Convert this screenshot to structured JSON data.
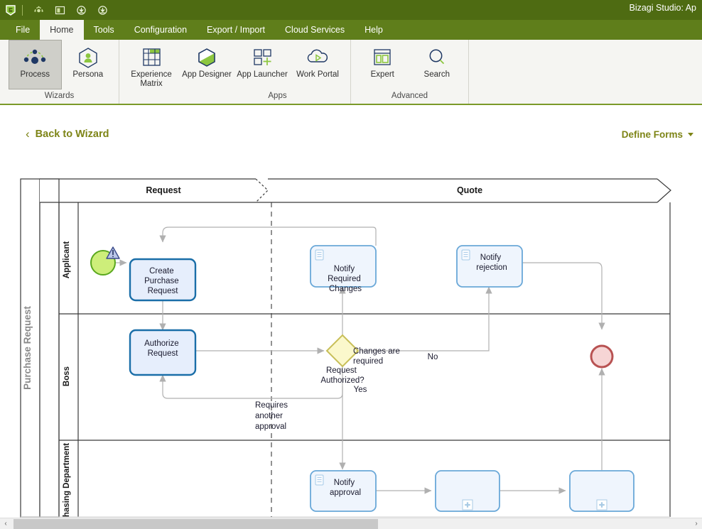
{
  "window": {
    "title": "Bizagi Studio: Ap",
    "accent_green": "#4e6b12",
    "menu_green": "#5f7e1b",
    "ribbon_bg": "#f5f5f2",
    "link_olive": "#7d8416"
  },
  "quick_access": {
    "logo_icon": "bizagi-logo-icon",
    "buttons": [
      {
        "icon": "refresh-circle-icon",
        "name": "quick-refresh"
      },
      {
        "icon": "window-panel-icon",
        "name": "quick-window"
      },
      {
        "icon": "download-circle-icon",
        "name": "quick-download"
      },
      {
        "icon": "download-circle-icon",
        "name": "quick-publish"
      }
    ]
  },
  "menu": {
    "tabs": [
      {
        "label": "File",
        "active": false
      },
      {
        "label": "Home",
        "active": true
      },
      {
        "label": "Tools",
        "active": false
      },
      {
        "label": "Configuration",
        "active": false
      },
      {
        "label": "Export / Import",
        "active": false
      },
      {
        "label": "Cloud Services",
        "active": false
      },
      {
        "label": "Help",
        "active": false
      }
    ]
  },
  "ribbon": {
    "groups": [
      {
        "label": "Wizards",
        "buttons": [
          {
            "label": "Process",
            "icon": "process-nodes-icon",
            "selected": true
          },
          {
            "label": "Persona",
            "icon": "persona-hexagon-icon",
            "selected": false
          }
        ]
      },
      {
        "label": "Apps",
        "buttons": [
          {
            "label": "Experience Matrix",
            "icon": "matrix-grid-icon",
            "selected": false
          },
          {
            "label": "App Designer",
            "icon": "hexagon-designer-icon",
            "selected": false
          },
          {
            "label": "App Launcher",
            "icon": "app-launcher-plus-icon",
            "selected": false
          },
          {
            "label": "Work Portal",
            "icon": "cloud-play-icon",
            "selected": false
          }
        ]
      },
      {
        "label": "Advanced",
        "buttons": [
          {
            "label": "Expert",
            "icon": "expert-panels-icon",
            "selected": false
          },
          {
            "label": "Search",
            "icon": "search-magnifier-icon",
            "selected": false
          }
        ]
      }
    ]
  },
  "subheader": {
    "back_label": "Back to Wizard",
    "back_icon": "chevron-left-icon",
    "define_forms_label": "Define Forms",
    "define_forms_icon": "chevron-down-icon"
  },
  "diagram": {
    "pool_label": "Purchase Request",
    "lanes": [
      {
        "label": "Applicant"
      },
      {
        "label": "Boss"
      },
      {
        "label": "hasing Department"
      }
    ],
    "phases": [
      {
        "label": "Request"
      },
      {
        "label": "Quote"
      }
    ],
    "events": [
      {
        "name": "start-event",
        "type": "start",
        "label": "",
        "fill": "#cdee7a",
        "stroke": "#5aa81e"
      },
      {
        "name": "end-event",
        "type": "end",
        "label": "",
        "fill": "#f6d5d5",
        "stroke": "#b85252"
      }
    ],
    "warning_icon": "warning-triangle-icon",
    "tasks": [
      {
        "name": "create-purchase-request",
        "label": "Create Purchase Request",
        "marker": "none",
        "selected": true
      },
      {
        "name": "notify-required-changes",
        "label": "Notify Required Changes",
        "marker": "user",
        "selected": false
      },
      {
        "name": "notify-rejection",
        "label": "Notify rejection",
        "marker": "user",
        "selected": false
      },
      {
        "name": "authorize-request",
        "label": "Authorize Request",
        "marker": "none",
        "selected": true
      },
      {
        "name": "notify-approval",
        "label": "Notify approval",
        "marker": "user",
        "selected": false
      },
      {
        "name": "subprocess-1",
        "label": "",
        "marker": "plus",
        "selected": false
      },
      {
        "name": "subprocess-2",
        "label": "",
        "marker": "plus",
        "selected": false
      }
    ],
    "gateway": {
      "name": "request-authorized-gateway",
      "label": "Request Authorized?",
      "fill": "#fbf8cc",
      "stroke": "#c8bf59"
    },
    "flow_labels": [
      {
        "name": "flow-label-changes-required",
        "text": "Changes are required"
      },
      {
        "name": "flow-label-no",
        "text": "No"
      },
      {
        "name": "flow-label-yes",
        "text": "Yes"
      },
      {
        "name": "flow-label-requires-another-approval",
        "text": "Requires another approval"
      }
    ]
  },
  "scrollbar": {
    "left_icon": "chevron-left-icon",
    "right_icon": "chevron-right-icon"
  }
}
